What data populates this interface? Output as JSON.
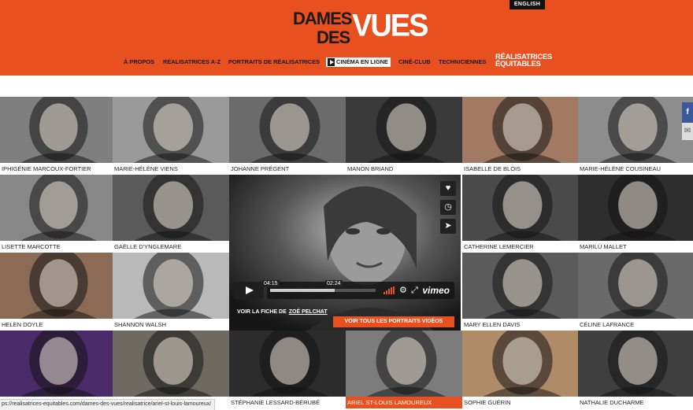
{
  "header": {
    "language_label": "ENGLISH",
    "logo": {
      "line1": "DAMES",
      "line2": "DES",
      "line3": "VUES"
    },
    "nav": {
      "items": [
        "À PROPOS",
        "RÉALISATRICES A-Z",
        "PORTRAITS DE RÉALISATRICES",
        "CINÉMA EN LIGNE",
        "CINÉ-CLUB",
        "TECHNICIENNES"
      ],
      "equitables": [
        "RÉALISATRICES",
        "ÉQUITABLES"
      ]
    }
  },
  "portraits": [
    {
      "name": "IPHIGÉNIE MARCOUX-FORTIER",
      "tone": "#7f7f7f"
    },
    {
      "name": "MARIE-HÉLÈNE VIENS",
      "tone": "#9a9a9a"
    },
    {
      "name": "JOHANNE PRÉGENT",
      "tone": "#6b6b6b"
    },
    {
      "name": "MANON BRIAND",
      "tone": "#3a3a3a"
    },
    {
      "name": "ISABELLE DE BLOIS",
      "tone": "#a27a63"
    },
    {
      "name": "MARIE-HÉLÈNE COUSINEAU",
      "tone": "#8d8d8d"
    },
    {
      "name": "LISETTE MARCOTTE",
      "tone": "#878787"
    },
    {
      "name": "GAËLLE D'YNGLEMARE",
      "tone": "#5a5a5a"
    },
    {
      "name": "CATHERINE LEMERCIER",
      "tone": "#4a4a4a"
    },
    {
      "name": "MARILÚ MALLET",
      "tone": "#2e2e2e"
    },
    {
      "name": "HELEN DOYLE",
      "tone": "#8b6b55"
    },
    {
      "name": "SHANNON WALSH",
      "tone": "#b9b9b9"
    },
    {
      "name": "MARY ELLEN DAVIS",
      "tone": "#5b5b5b"
    },
    {
      "name": "CÉLINE LAFRANCE",
      "tone": "#6a6a6a"
    },
    {
      "name": "",
      "tone": "#4b2a6a"
    },
    {
      "name": "",
      "tone": "#6e6a62"
    },
    {
      "name": "STÉPHANIE LESSARD-BÉRUBÉ",
      "tone": "#2c2c2c"
    },
    {
      "name": "ARIEL ST-LOUIS LAMOUREUX",
      "tone": "#7c7c7c"
    },
    {
      "name": "SOPHIE GUÉRIN",
      "tone": "#b08b68"
    },
    {
      "name": "NATHALIE DUCHARME",
      "tone": "#3f3f3f"
    }
  ],
  "video": {
    "time_current": "04:15",
    "time_hover": "02:24",
    "progress": 0.61,
    "brand": "vimeo",
    "credit_prefix": "VOIR LA FICHE DE",
    "credit_link": "ZOÉ PELCHAT",
    "all_videos_button": "VOIR TOUS LES PORTRAITS VIDÉOS"
  },
  "share": {
    "facebook": "f",
    "mail": "✉"
  },
  "status_bar": "ps://realisatrices-equitables.com/dames-des-vues/realisatrice/ariel-st-louis-lamoureux/"
}
